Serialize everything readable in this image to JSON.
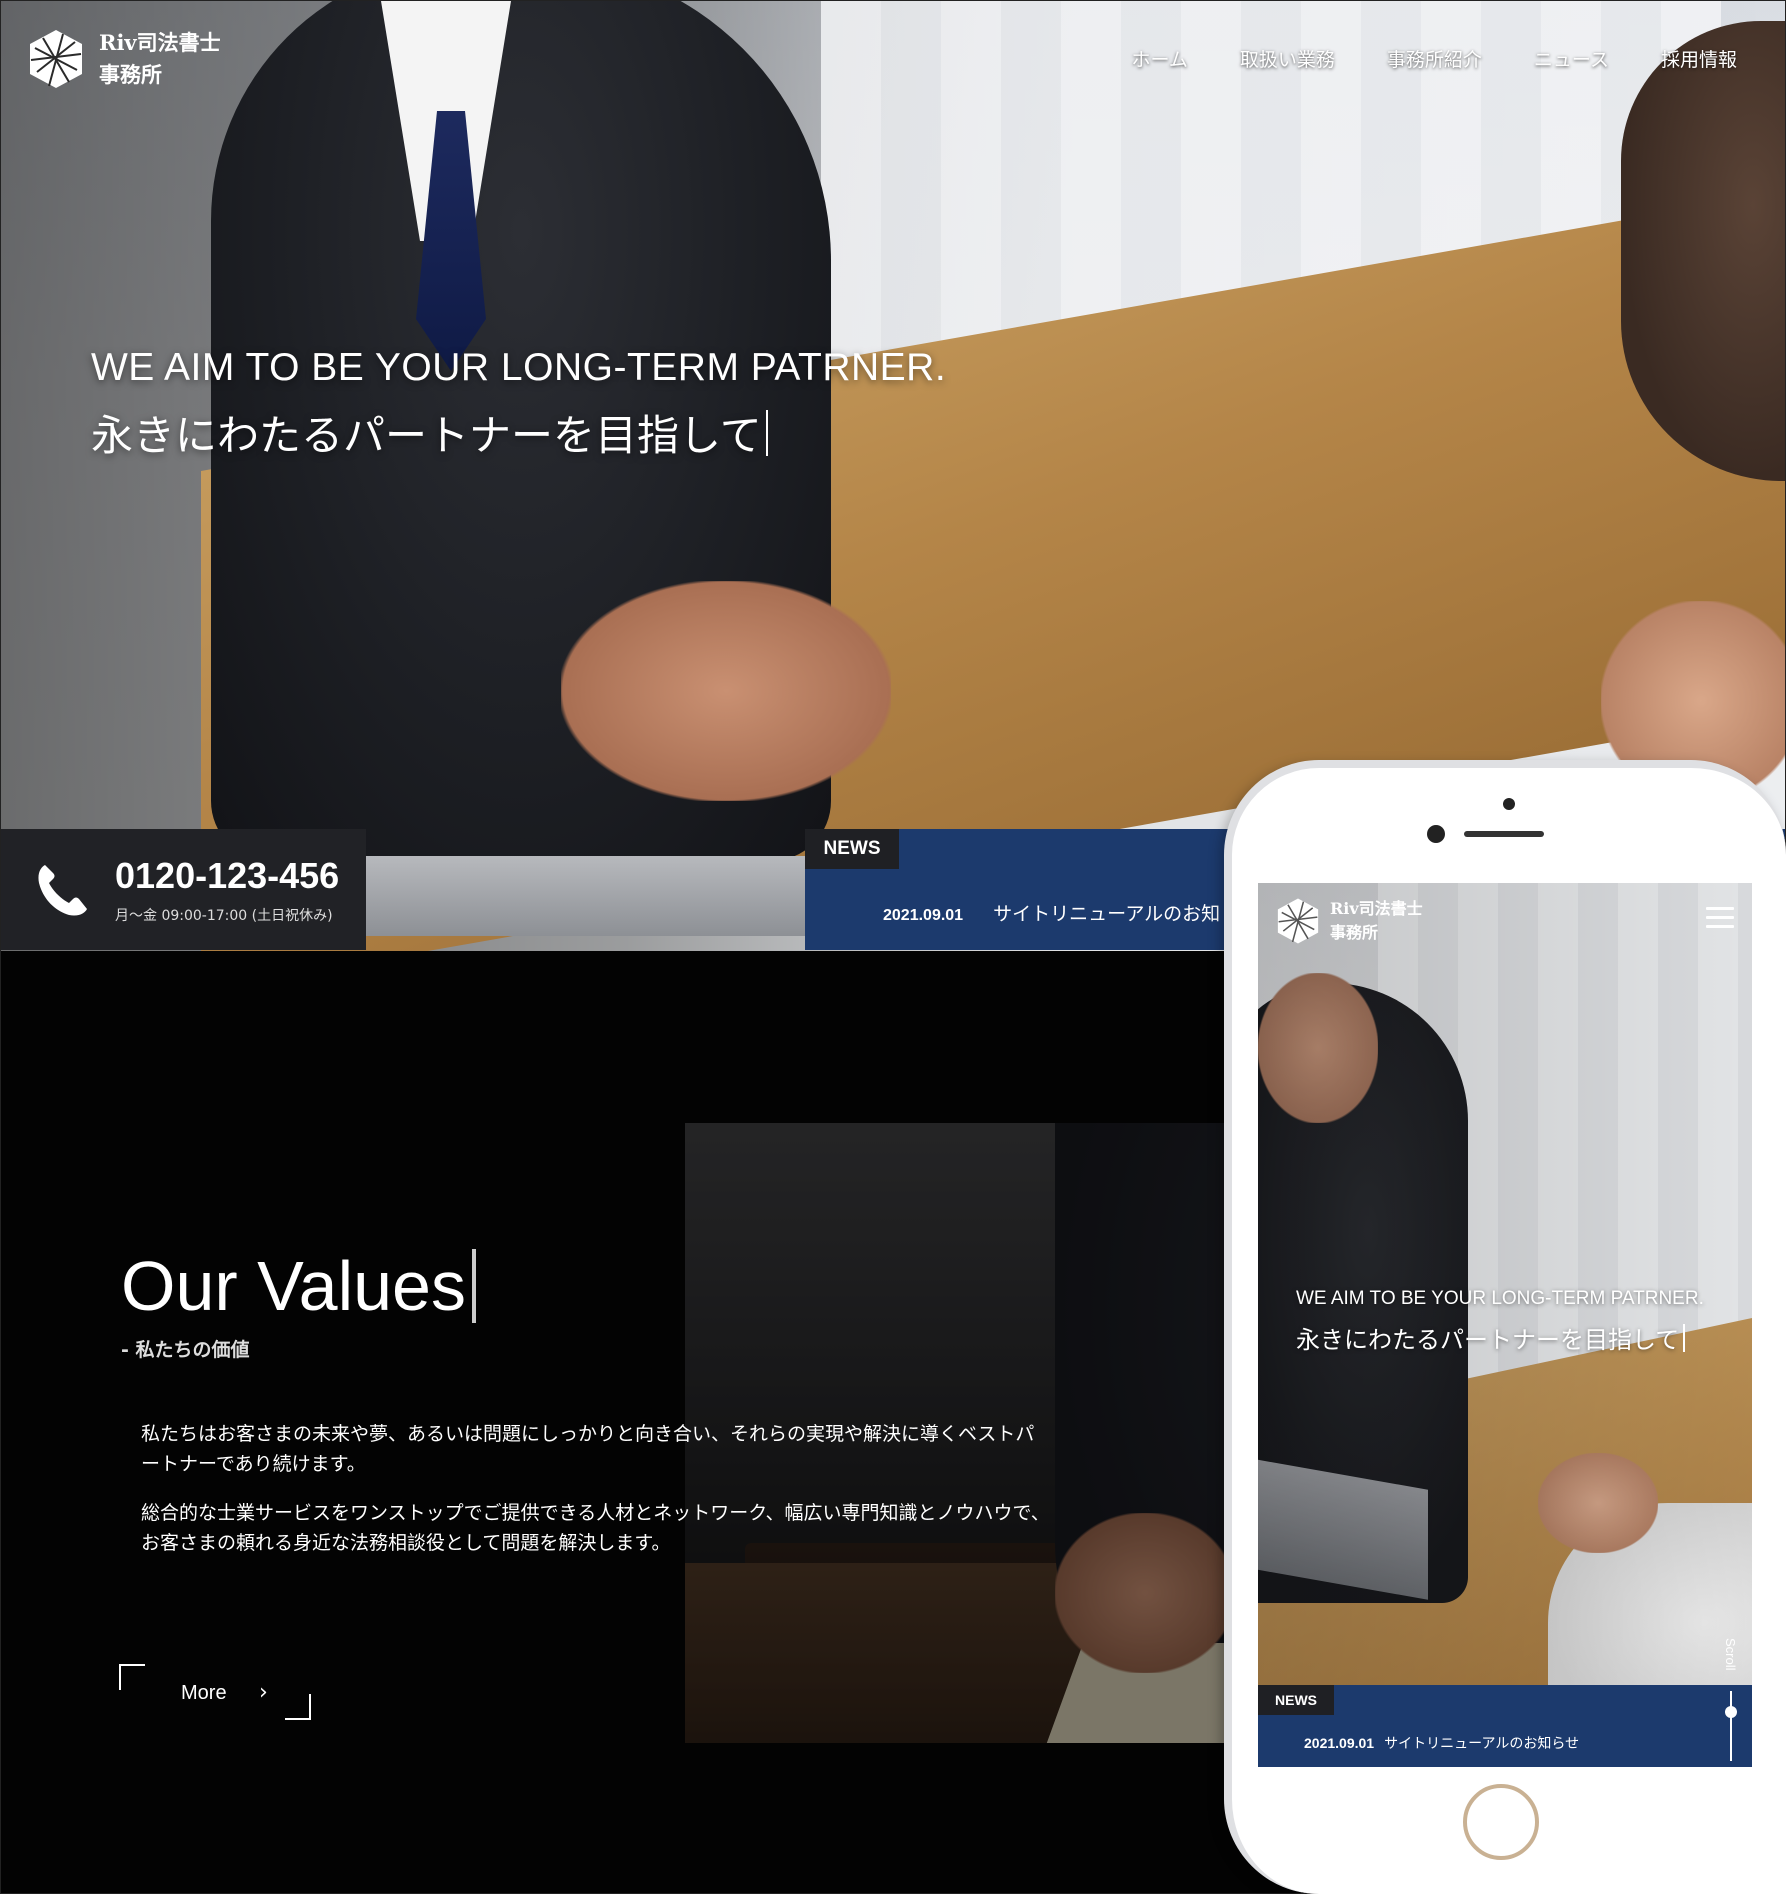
{
  "brand": {
    "name_line1": "Riv司法書士",
    "name_line2": "事務所"
  },
  "nav": [
    {
      "label": "ホーム"
    },
    {
      "label": "取扱い業務"
    },
    {
      "label": "事務所紹介"
    },
    {
      "label": "ニュース"
    },
    {
      "label": "採用情報"
    }
  ],
  "hero": {
    "headline_en": "WE AIM TO BE YOUR LONG-TERM PATRNER.",
    "headline_ja": "永きにわたるパートナーを目指して"
  },
  "contact": {
    "phone": "0120-123-456",
    "hours": "月〜金 09:00-17:00 (土日祝休み)"
  },
  "news": {
    "tag": "NEWS",
    "items": [
      {
        "date": "2021.09.01",
        "title": "サイトリニューアルのお知"
      }
    ]
  },
  "values": {
    "title": "Our Values",
    "subtitle": "- 私たちの価値",
    "paragraph1_line1": "私たちはお客さまの未来や夢、あるいは問題にしっかりと向き合い、それらの実現や解決に導くベストパ",
    "paragraph1_line2": "ートナーであり続けます。",
    "paragraph2_line1": "総合的な士業サービスをワンストップでご提供できる人材とネットワーク、幅広い専門知識とノウハウで、",
    "paragraph2_line2": "お客さまの頼れる身近な法務相談役として問題を解決します。",
    "more_label": "More",
    "more_arrow": "›"
  },
  "mobile": {
    "brand_line1": "Riv司法書士",
    "brand_line2": "事務所",
    "headline_en": "WE AIM TO BE YOUR LONG-TERM PATRNER.",
    "headline_ja": "永きにわたるパートナーを目指して",
    "scroll_label": "Scroll",
    "news_tag": "NEWS",
    "news_date": "2021.09.01",
    "news_title": "サイトリニューアルのお知らせ"
  },
  "icons": {
    "logo": "geometric-hexagon-logo-icon",
    "phone": "phone-handset-icon",
    "menu": "hamburger-menu-icon",
    "more_arrow": "chevron-right-icon"
  },
  "colors": {
    "news_bar": "#1c3a6d",
    "phone_bar": "#212226",
    "tag_bg": "#1f2024",
    "home_button_ring": "#c9b193",
    "page_bg": "#030303"
  }
}
